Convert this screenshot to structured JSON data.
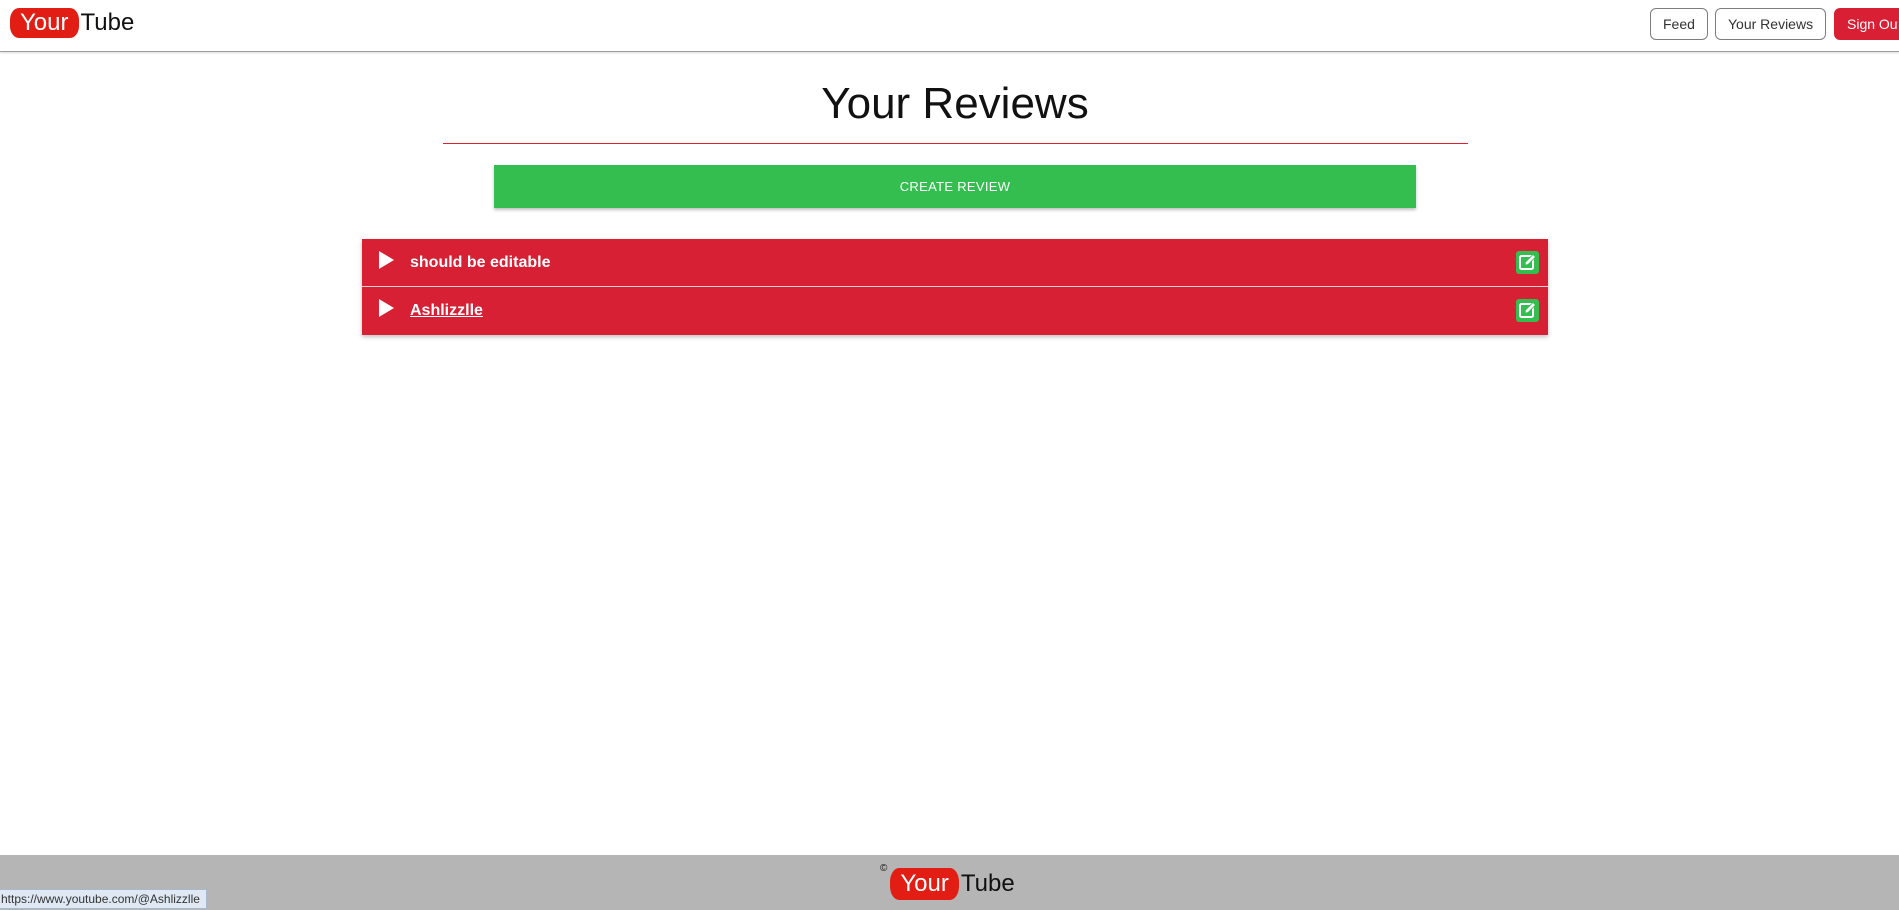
{
  "brand": {
    "part1": "Your",
    "part2": "Tube",
    "accent_color": "#e21d14"
  },
  "nav": {
    "feed_label": "Feed",
    "reviews_label": "Your Reviews",
    "signout_label": "Sign Out"
  },
  "main": {
    "title": "Your Reviews",
    "create_label": "CREATE REVIEW",
    "create_color": "#34be50",
    "row_color": "#d82035",
    "reviews": [
      {
        "title": "should be editable",
        "is_link": false,
        "icons": [
          "play-icon",
          "edit-icon"
        ]
      },
      {
        "title": "Ashlizzlle",
        "is_link": true,
        "icons": [
          "play-icon",
          "edit-icon"
        ]
      }
    ]
  },
  "footer": {
    "copyright": "©",
    "part1": "Your",
    "part2": "Tube"
  },
  "status_bar": {
    "url": "https://www.youtube.com/@Ashlizzlle"
  }
}
